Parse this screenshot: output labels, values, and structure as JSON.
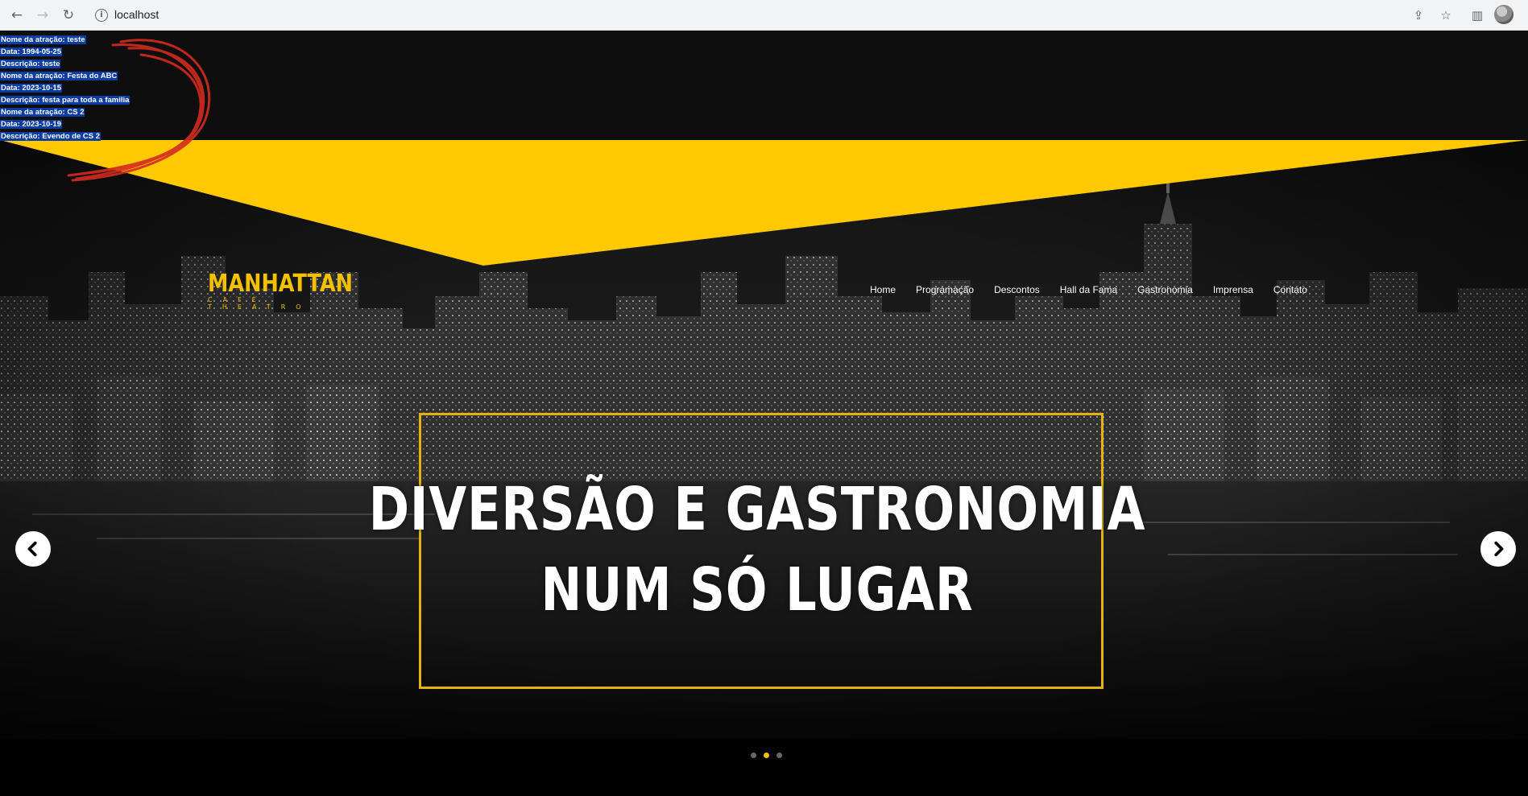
{
  "browser": {
    "url": "localhost",
    "back_icon": "arrow-left-icon",
    "forward_icon": "arrow-right-icon",
    "reload_icon": "reload-icon"
  },
  "debug_lines": [
    "Nome da atração: teste",
    "Data: 1994-05-25",
    "Descrição: teste",
    "Nome da atração: Festa do ABC",
    "Data: 2023-10-15",
    "Descrição: festa para toda a familia",
    "Nome da atração: CS 2",
    "Data: 2023-10-19",
    "Descrição: Evendo de CS 2"
  ],
  "logo": {
    "main": "MANHATTAN",
    "sub": "CAFÉ THEATRO"
  },
  "menu": [
    "Home",
    "Programação",
    "Descontos",
    "Hall da Fama",
    "Gastronomia",
    "Imprensa",
    "Contato"
  ],
  "hero": {
    "line1": "DIVERSÃO E GASTRONOMIA",
    "line2": "NUM SÓ LUGAR"
  },
  "carousel": {
    "slides": 3,
    "active": 2
  },
  "colors": {
    "accent": "#f2c100",
    "frame": "#e3b312",
    "scribble": "#d42a1f",
    "background": "#0a0a0a"
  }
}
